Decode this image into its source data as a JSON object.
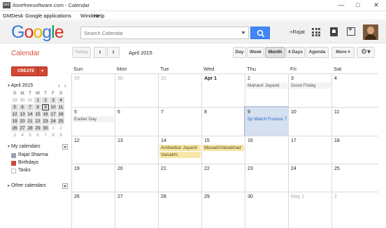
{
  "window": {
    "title": "ilovefreesoftware.com - Calendar",
    "icon_text": "GAI",
    "menu": [
      "GMDesk",
      "Google applications",
      "Window",
      "Help"
    ]
  },
  "header": {
    "logo_text": "Google",
    "search_placeholder": "Search Calendar",
    "user_label": "+Rajat",
    "icons": [
      "search-icon",
      "apps-icon",
      "notification-icon",
      "share-icon",
      "avatar"
    ]
  },
  "toolbar": {
    "app_title": "Calendar",
    "today_label": "Today",
    "prev_label": "‹",
    "next_label": "›",
    "period_label": "April 2015",
    "views": [
      "Day",
      "Week",
      "Month",
      "4 Days",
      "Agenda"
    ],
    "more_label": "More ▾",
    "settings_label": "⚙▾"
  },
  "sidebar": {
    "create_label": "CREATE",
    "mini_title": "April 2015",
    "mini_prev": "‹",
    "mini_next": "›",
    "mini_days": [
      "S",
      "M",
      "T",
      "W",
      "T",
      "F",
      "S"
    ],
    "mini_weeks": [
      [
        "29",
        "30",
        "31",
        "1",
        "2",
        "3",
        "4"
      ],
      [
        "5",
        "6",
        "7",
        "8",
        "9",
        "10",
        "11"
      ],
      [
        "12",
        "13",
        "14",
        "15",
        "16",
        "17",
        "18"
      ],
      [
        "19",
        "20",
        "21",
        "22",
        "23",
        "24",
        "25"
      ],
      [
        "26",
        "27",
        "28",
        "29",
        "30",
        "1",
        "2"
      ],
      [
        "3",
        "4",
        "5",
        "6",
        "7",
        "8",
        "9"
      ]
    ],
    "my_calendars_label": "My calendars",
    "my_calendars": [
      {
        "label": "Rajat Sharma",
        "color": "#9aa0b4"
      },
      {
        "label": "Birthdays",
        "color": "#c9493b"
      },
      {
        "label": "Tasks",
        "color": "#ffffff"
      }
    ],
    "other_calendars_label": "Other calendars"
  },
  "month": {
    "weekdays": [
      "Sun",
      "Mon",
      "Tue",
      "Wed",
      "Thu",
      "Fri",
      "Sat"
    ],
    "weeks": [
      [
        "29",
        "30",
        "31",
        "Apr 1",
        "2",
        "3",
        "4"
      ],
      [
        "5",
        "6",
        "7",
        "8",
        "9",
        "10",
        "11"
      ],
      [
        "12",
        "13",
        "14",
        "15",
        "16",
        "17",
        "18"
      ],
      [
        "19",
        "20",
        "21",
        "22",
        "23",
        "24",
        "25"
      ],
      [
        "26",
        "27",
        "28",
        "29",
        "30",
        "May 1",
        "2"
      ]
    ],
    "events": [
      {
        "week": 0,
        "day": 4,
        "slot": 0,
        "text": "Mahavir Jayanti",
        "style": "gray"
      },
      {
        "week": 0,
        "day": 5,
        "slot": 0,
        "text": "Good Friday",
        "style": "gray"
      },
      {
        "week": 1,
        "day": 0,
        "slot": 0,
        "text": "Easter Day",
        "style": "gray"
      },
      {
        "week": 1,
        "day": 4,
        "slot": 0,
        "text": "5p Watch Furious 7",
        "style": "blue"
      },
      {
        "week": 2,
        "day": 2,
        "slot": 0,
        "text": "Ambedkar Jayanti",
        "style": "yellow"
      },
      {
        "week": 2,
        "day": 3,
        "slot": 0,
        "text": "Mesadi/Vaisakhad",
        "style": "yellow"
      },
      {
        "week": 2,
        "day": 2,
        "slot": 1,
        "text": "Vaisakhi",
        "style": "yellow"
      }
    ]
  }
}
